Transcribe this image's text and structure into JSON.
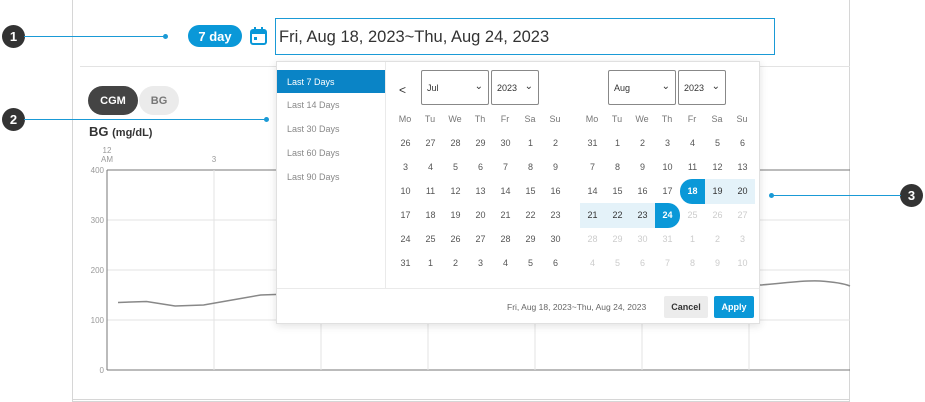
{
  "callouts": [
    "1",
    "2",
    "3"
  ],
  "header": {
    "day_pill": "7 day",
    "date_range": "Fri, Aug 18, 2023~Thu, Aug 24, 2023"
  },
  "toggles": {
    "cgm": "CGM",
    "bg": "BG"
  },
  "chart_title": {
    "main": "BG",
    "unit": "(mg/dL)"
  },
  "chart_data": {
    "type": "line",
    "ylabel": "BG (mg/dL)",
    "ylim": [
      0,
      400
    ],
    "y_ticks": [
      "400",
      "300",
      "200",
      "100",
      "0"
    ],
    "x_ticks": [
      "12\nAM",
      "3"
    ],
    "x_tick_12": "12",
    "x_tick_am": "AM",
    "x_tick_3": "3",
    "series": [
      {
        "x": [
          0,
          0.5,
          1,
          1.5,
          2,
          2.5,
          3
        ],
        "y": [
          135,
          137,
          128,
          130,
          140,
          150,
          152
        ]
      }
    ],
    "grid": true
  },
  "presets": [
    "Last 7 Days",
    "Last 14 Days",
    "Last 30 Days",
    "Last 60 Days",
    "Last 90 Days"
  ],
  "left_cal": {
    "month": "Jul",
    "year": "2023"
  },
  "right_cal": {
    "month": "Aug",
    "year": "2023"
  },
  "nav_prev": "<",
  "weekdays": [
    "Mo",
    "Tu",
    "We",
    "Th",
    "Fr",
    "Sa",
    "Su"
  ],
  "footer": {
    "range": "Fri, Aug 18, 2023~Thu, Aug 24, 2023",
    "cancel": "Cancel",
    "apply": "Apply"
  },
  "colors": {
    "accent": "#0a98d8",
    "range_bg": "#e4f2f9",
    "dark_toggle": "#444444"
  }
}
